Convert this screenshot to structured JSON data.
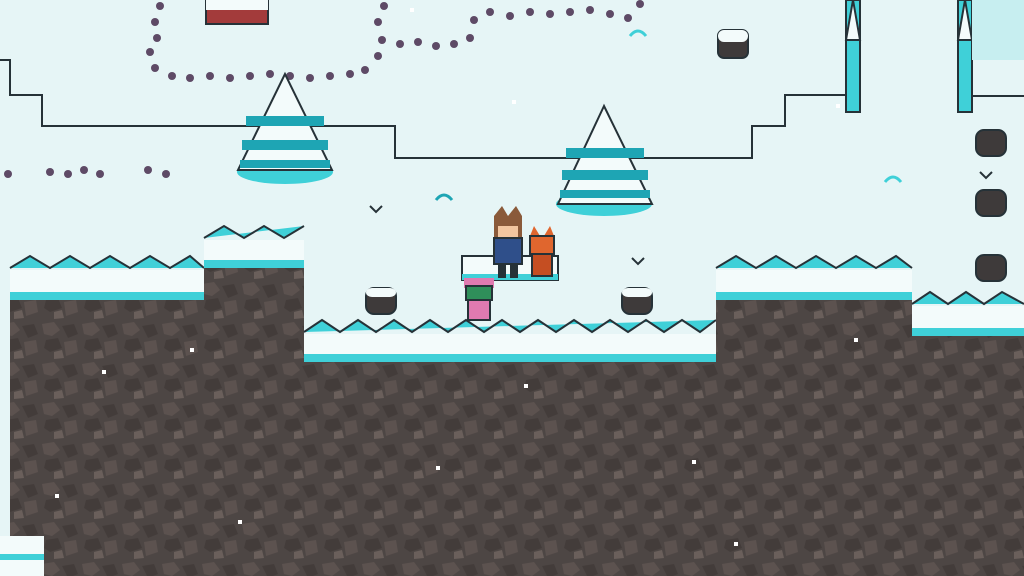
{
  "scene": {
    "type": "top-down snowy area",
    "colors": {
      "snow": "#e6f5f6",
      "snow_highlight": "#f3fbfb",
      "ice_accent": "#3fd0d8",
      "ice_accent_dark": "#1ea5b4",
      "rock": "#4d4644",
      "outline": "#263238",
      "berry": "#5e4a66"
    },
    "characters": [
      {
        "name": "brown-haired-boy",
        "colors": {
          "hair": "#8a5a3a",
          "outfit": "#2f4f8a"
        }
      },
      {
        "name": "orange-fox",
        "colors": {
          "fur": "#e0662e"
        }
      },
      {
        "name": "pink-girl-with-green-hat",
        "colors": {
          "hat": "#2f8f5a",
          "dress": "#e07ab0"
        }
      }
    ],
    "objects": [
      "snowy-pine-tree-left",
      "snowy-pine-tree-center",
      "snow-bench",
      "snow-stump",
      "frozen-fence"
    ]
  }
}
